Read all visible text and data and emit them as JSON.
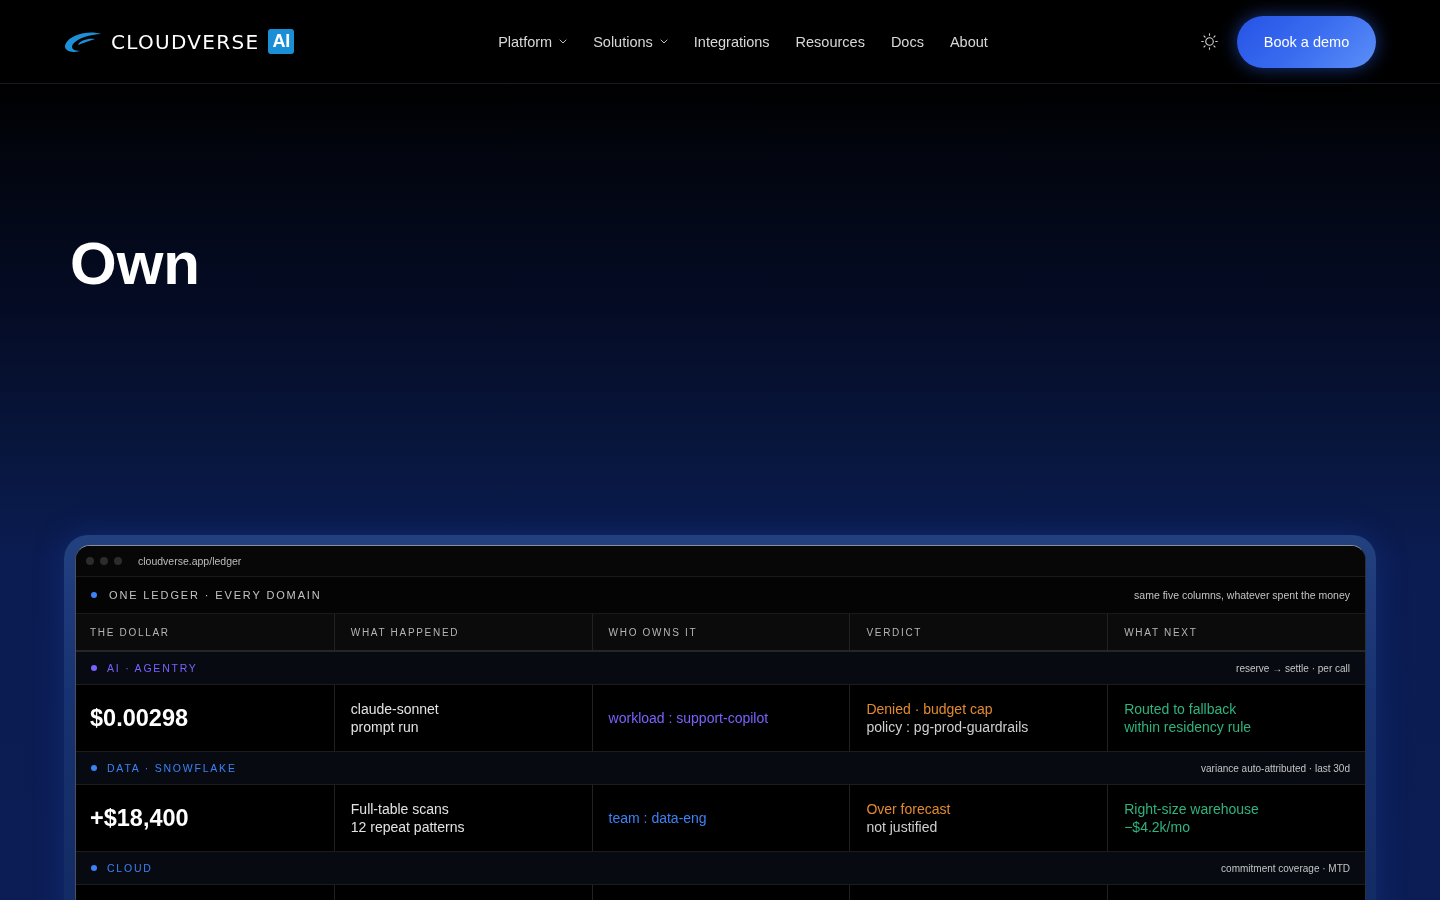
{
  "brand": {
    "name": "CLOUDVERSE",
    "badge": "AI"
  },
  "nav": {
    "links": [
      {
        "label": "Platform",
        "has_menu": true
      },
      {
        "label": "Solutions",
        "has_menu": true
      },
      {
        "label": "Integrations",
        "has_menu": false
      },
      {
        "label": "Resources",
        "has_menu": false
      },
      {
        "label": "Docs",
        "has_menu": false
      },
      {
        "label": "About",
        "has_menu": false
      }
    ],
    "cta": "Book a demo"
  },
  "hero": {
    "heading": "Own"
  },
  "ledger": {
    "url": "cloudverse.app/ledger",
    "title": "ONE LEDGER · EVERY DOMAIN",
    "subtitle": "same five columns, whatever spent the money",
    "columns": [
      "THE DOLLAR",
      "WHAT HAPPENED",
      "WHO OWNS IT",
      "VERDICT",
      "WHAT NEXT"
    ],
    "sections": [
      {
        "label": "AI · AGENTRY",
        "color": "#7b61ff",
        "note": "reserve → settle · per call",
        "rows": [
          {
            "amount": "$0.00298",
            "event": [
              "claude-sonnet",
              "prompt run"
            ],
            "owner": "workload : support-copilot",
            "verdict": {
              "status": "Denied · budget cap",
              "detail": "policy : pg-prod-guardrails"
            },
            "next": [
              "Routed to fallback",
              "within residency rule"
            ]
          }
        ]
      },
      {
        "label": "DATA · SNOWFLAKE",
        "color": "#3b82f6",
        "note": "variance auto-attributed · last 30d",
        "rows": [
          {
            "amount": "+$18,400",
            "event": [
              "Full-table scans",
              "12 repeat patterns"
            ],
            "owner": "team : data-eng",
            "verdict": {
              "status": "Over forecast",
              "detail": "not justified"
            },
            "next": [
              "Right-size warehouse",
              "−$4.2k/mo"
            ]
          }
        ]
      },
      {
        "label": "CLOUD",
        "color": "#3b82f6",
        "note": "commitment coverage · MTD"
      }
    ]
  }
}
